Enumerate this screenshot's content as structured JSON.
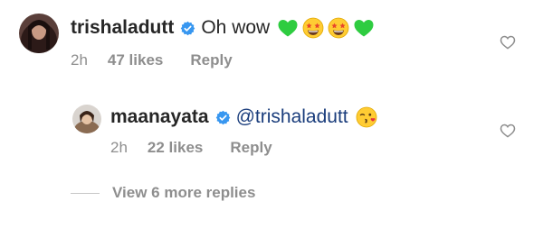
{
  "comments": [
    {
      "username": "trishaladutt",
      "text": "Oh wow",
      "emojis": [
        "green-heart",
        "star-struck",
        "star-struck",
        "green-heart"
      ],
      "time": "2h",
      "likes": "47 likes",
      "reply_label": "Reply"
    }
  ],
  "replies": [
    {
      "username": "maanayata",
      "mention": "@trishaladutt",
      "emojis": [
        "kissing-face"
      ],
      "time": "2h",
      "likes": "22 likes",
      "reply_label": "Reply"
    }
  ],
  "view_more_label": "View 6 more replies",
  "colors": {
    "verified": "#3897f0",
    "mention": "#1a3d7c",
    "meta": "#8e8e8e",
    "green_heart": "#2ecc40"
  }
}
